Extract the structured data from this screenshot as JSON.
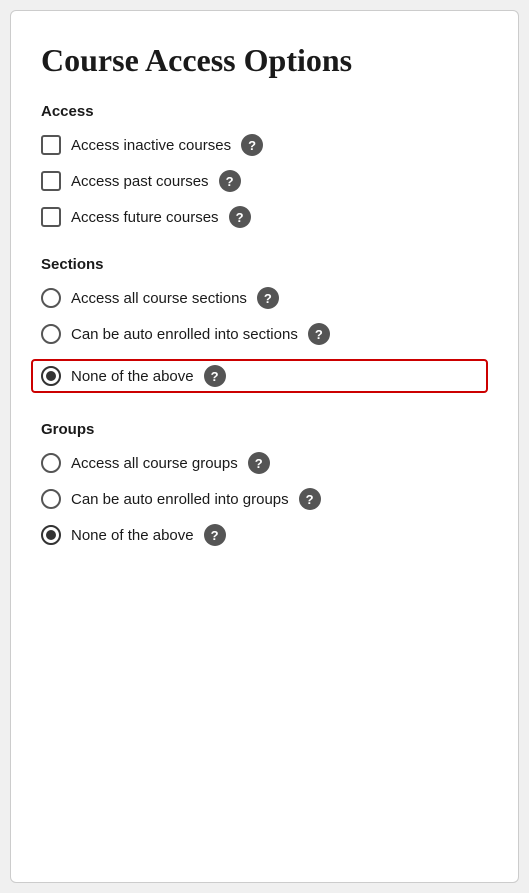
{
  "page": {
    "title": "Course Access Options"
  },
  "sections": [
    {
      "id": "access",
      "label": "Access",
      "type": "checkbox",
      "options": [
        {
          "id": "access-inactive",
          "label": "Access inactive courses",
          "checked": false
        },
        {
          "id": "access-past",
          "label": "Access past courses",
          "checked": false
        },
        {
          "id": "access-future",
          "label": "Access future courses",
          "checked": false
        }
      ]
    },
    {
      "id": "sections",
      "label": "Sections",
      "type": "radio",
      "options": [
        {
          "id": "sections-all",
          "label": "Access all course sections",
          "checked": false,
          "highlighted": false
        },
        {
          "id": "sections-auto",
          "label": "Can be auto enrolled into sections",
          "checked": false,
          "highlighted": false
        },
        {
          "id": "sections-none",
          "label": "None of the above",
          "checked": true,
          "highlighted": true
        }
      ]
    },
    {
      "id": "groups",
      "label": "Groups",
      "type": "radio",
      "options": [
        {
          "id": "groups-all",
          "label": "Access all course groups",
          "checked": false,
          "highlighted": false
        },
        {
          "id": "groups-auto",
          "label": "Can be auto enrolled into groups",
          "checked": false,
          "highlighted": false
        },
        {
          "id": "groups-none",
          "label": "None of the above",
          "checked": true,
          "highlighted": false
        }
      ]
    }
  ],
  "icons": {
    "help": "?"
  }
}
